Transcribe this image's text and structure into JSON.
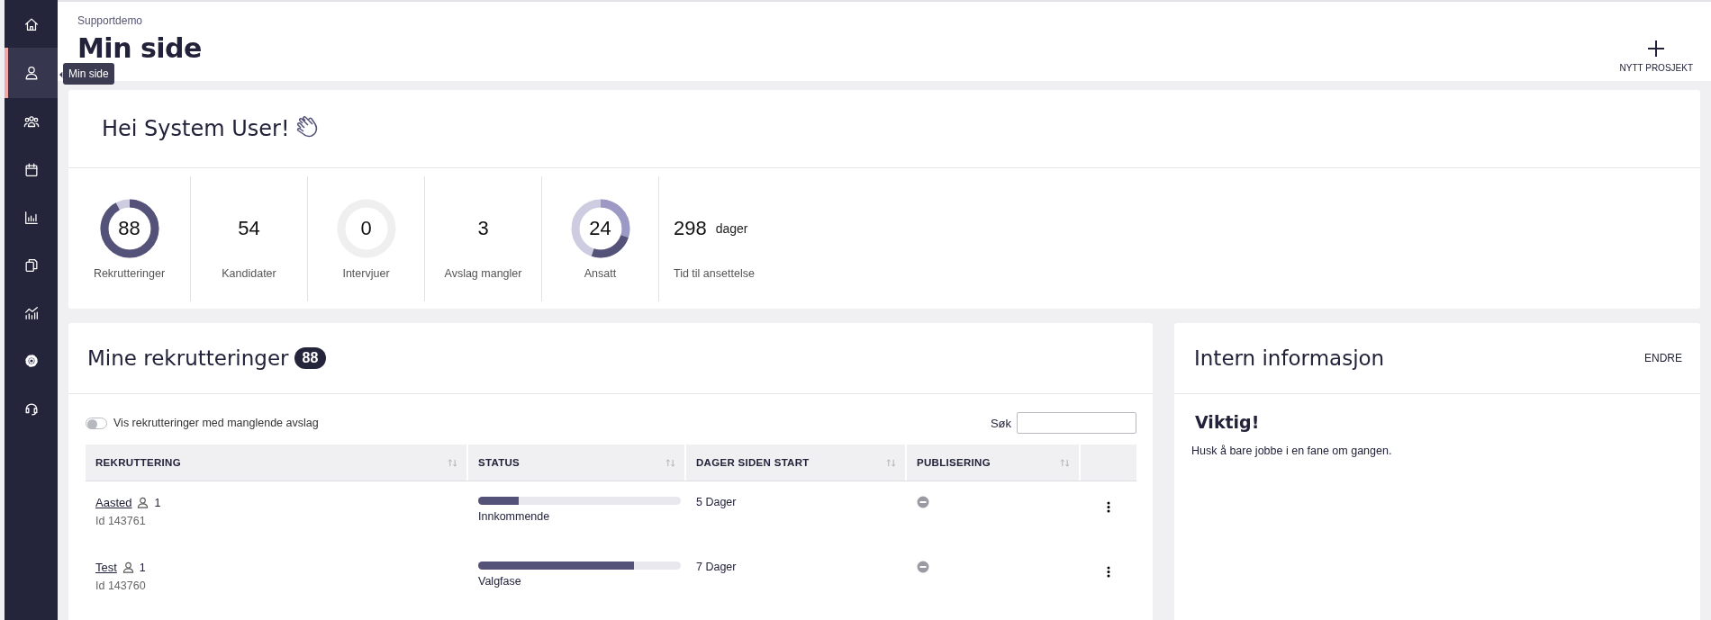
{
  "sidebar": {
    "items": [
      {
        "selected": false
      },
      {
        "selected": true
      },
      {
        "selected": false
      },
      {
        "selected": false
      },
      {
        "selected": false
      },
      {
        "selected": false
      },
      {
        "selected": false
      },
      {
        "selected": false
      },
      {
        "selected": false
      }
    ],
    "tooltip": "Min side"
  },
  "header": {
    "breadcrumb": "Supportdemo",
    "title": "Min side",
    "action": "NYTT PROSJEKT"
  },
  "greeting": {
    "title": "Hei System User!"
  },
  "stats": [
    {
      "kind": "donut",
      "value": "88",
      "label": "Rekrutteringer",
      "segments": [
        {
          "level": 0.92,
          "color": "#545278"
        }
      ]
    },
    {
      "kind": "number",
      "value": "54",
      "label": "Kandidater"
    },
    {
      "kind": "donut",
      "value": "0",
      "label": "Intervjuer"
    },
    {
      "kind": "number",
      "value": "3",
      "label": "Avslag mangler"
    },
    {
      "kind": "donut",
      "value": "24",
      "label": "Ansatt",
      "segments": [
        {
          "level": 0.3,
          "color": "#9c9ac4"
        },
        {
          "level": 0.25,
          "color": "#545278"
        }
      ]
    },
    {
      "kind": "number",
      "value": "298",
      "unit": "dager",
      "label": "Tid til ansettelse"
    }
  ],
  "recruitments": {
    "title": "Mine rekrutteringer",
    "count": "88",
    "toggle": {
      "label": "Vis rekrutteringer med manglende avslag",
      "on": false
    },
    "search": {
      "label": "Søk"
    },
    "columns": [
      "REKRUTTERING",
      "STATUS",
      "DAGER SIDEN START",
      "PUBLISERING"
    ],
    "rows": [
      {
        "name": "Aasted",
        "candidates": "1",
        "id": "Id 143761",
        "status": "Innkommende",
        "level": 0.2,
        "days": "5 Dager"
      },
      {
        "name": "Test",
        "candidates": "1",
        "id": "Id 143760",
        "status": "Valgfase",
        "level": 0.77,
        "days": "7 Dager"
      }
    ]
  },
  "info": {
    "title": "Intern informasjon",
    "action": "ENDRE",
    "heading": "Viktig!",
    "text": "Husk å bare jobbe i en fane om gangen."
  }
}
